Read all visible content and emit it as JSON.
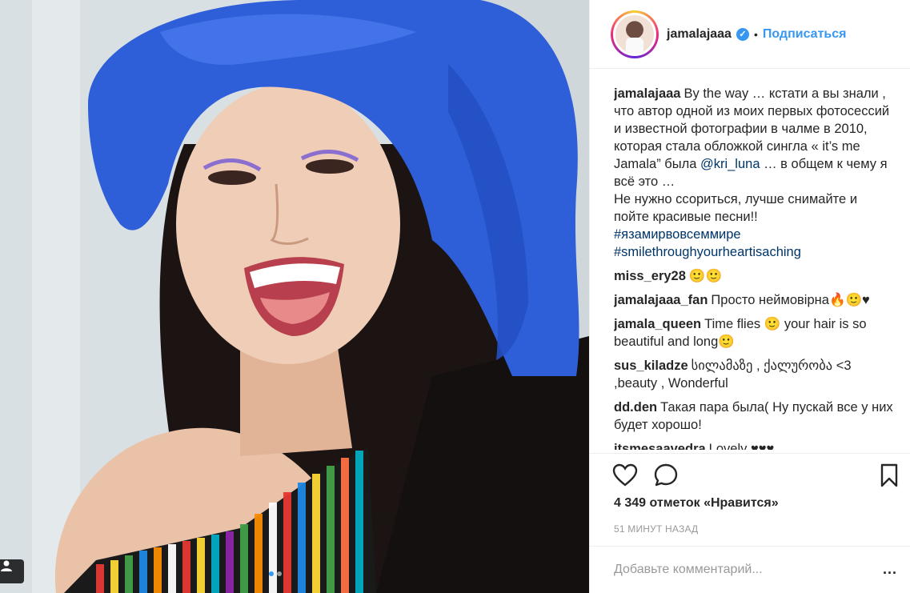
{
  "post": {
    "author": "jamalajaaa",
    "follow_label": "Подписаться",
    "separator": "•",
    "verified_glyph": "✓",
    "likes_text": "4 349 отметок «Нравится»",
    "time_text": "51 МИНУТ НАЗАД",
    "comment_placeholder": "Добавьте комментарий...",
    "more_label": "...",
    "accent_color": "#3897f0",
    "icons": [
      "heart-icon",
      "comment-icon",
      "bookmark-icon",
      "user-tag-icon",
      "verified-icon",
      "more-options-icon"
    ]
  },
  "caption": {
    "username": "jamalajaaa",
    "text_part1": "By the way … кстати а вы знали , что автор одной из моих первых фотосессий и известной фотографии в чалме в 2010, которая стала обложкой сингла « it’s me Jamala” была ",
    "mention": "@kri_luna",
    "text_part2": " … в общем к чему я всё это … \nНе нужно ссориться, лучше снимайте и пойте красивые песни!!",
    "hashtag1": "#язамирвовсеммире",
    "hashtag2": "#smilethroughyourheartisaching"
  },
  "comments": [
    {
      "username": "miss_ery28",
      "text": "🙂🙂"
    },
    {
      "username": "jamalajaaa_fan",
      "text": "Просто неймовірна🔥🙂♥"
    },
    {
      "username": "jamala_queen",
      "text": "Time flies 🙂 your hair is so beautiful and long🙂"
    },
    {
      "username": "sus_kiladze",
      "text": "სილამაზე , ქალურობა <3 ,beauty , Wonderful"
    },
    {
      "username": "dd.den",
      "text": "Такая пара была( Ну пускай все у них будет хорошо!"
    },
    {
      "username": "itsmesaavedra",
      "text": "Lovely ♥♥♥"
    }
  ]
}
